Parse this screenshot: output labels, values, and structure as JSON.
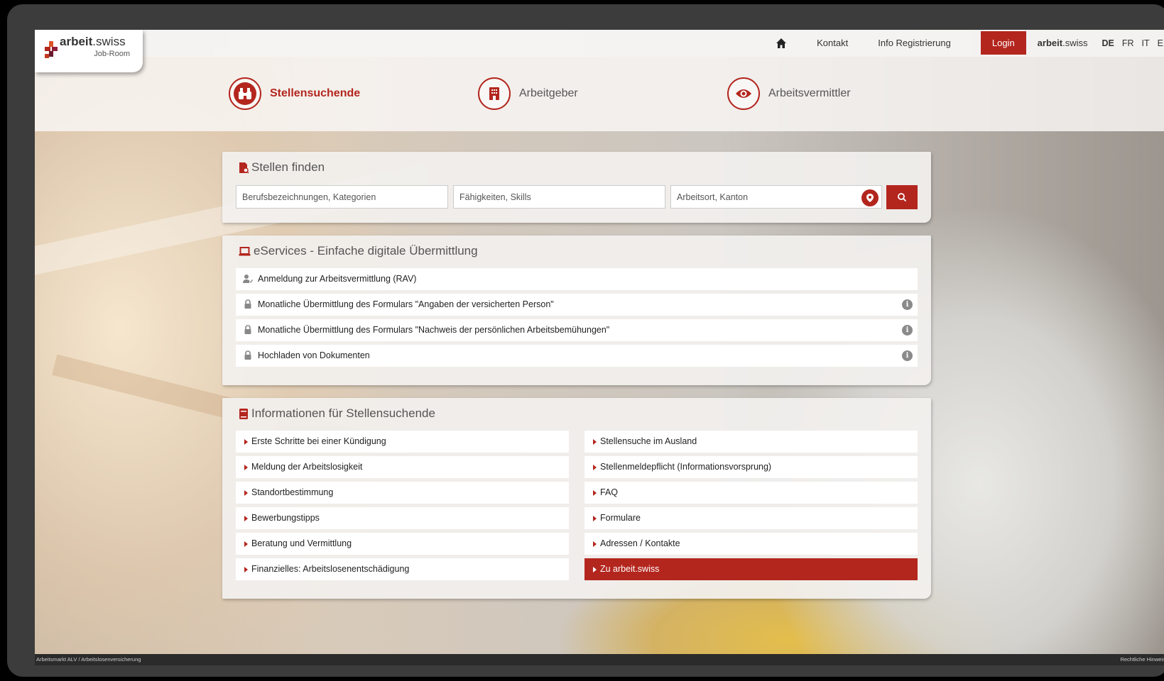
{
  "app": {
    "logo_brand_bold": "arbeit",
    "logo_brand_rest": ".swiss",
    "logo_sub": "Job-Room"
  },
  "nav": {
    "home_icon": "home-icon",
    "contact": "Kontakt",
    "info_registration": "Info Registrierung",
    "login": "Login",
    "brand_bold": "arbeit",
    "brand_rest": ".swiss",
    "languages": [
      "DE",
      "FR",
      "IT",
      "EN"
    ],
    "active_language": "DE"
  },
  "roles": [
    {
      "label": "Stellensuchende",
      "icon": "binoculars-icon",
      "active": true
    },
    {
      "label": "Arbeitgeber",
      "icon": "building-icon",
      "active": false
    },
    {
      "label": "Arbeitsvermittler",
      "icon": "eye-icon",
      "active": false
    }
  ],
  "search": {
    "title": "Stellen finden",
    "occupation_placeholder": "Berufsbezeichnungen, Kategorien",
    "skills_placeholder": "Fähigkeiten, Skills",
    "location_placeholder": "Arbeitsort, Kanton"
  },
  "eservices": {
    "title": "eServices - Einfache digitale Übermittlung",
    "items": [
      {
        "label": "Anmeldung zur Arbeitsvermittlung (RAV)",
        "icon": "user-edit-icon",
        "info": false
      },
      {
        "label": "Monatliche Übermittlung des Formulars \"Angaben der versicherten Person\"",
        "icon": "lock-icon",
        "info": true
      },
      {
        "label": "Monatliche Übermittlung des Formulars \"Nachweis der persönlichen Arbeitsbemühungen\"",
        "icon": "lock-icon",
        "info": true
      },
      {
        "label": "Hochladen von Dokumenten",
        "icon": "lock-icon",
        "info": true
      }
    ]
  },
  "info": {
    "title": "Informationen für Stellensuchende",
    "left": [
      "Erste Schritte bei einer Kündigung",
      "Meldung der Arbeitslosigkeit",
      "Standortbestimmung",
      "Bewerbungstipps",
      "Beratung und Vermittlung",
      "Finanzielles: Arbeitslosenentschädigung"
    ],
    "right": [
      "Stellensuche im Ausland",
      "Stellenmeldepflicht (Informationsvorsprung)",
      "FAQ",
      "Formulare",
      "Adressen / Kontakte",
      "Zu arbeit.swiss"
    ]
  },
  "footer": {
    "left": "Arbeitsmarkt ALV / Arbeitslosenversicherung",
    "right": "Rechtliche Hinweise"
  },
  "colors": {
    "accent": "#b3261e",
    "frame": "#3c3c3c"
  }
}
